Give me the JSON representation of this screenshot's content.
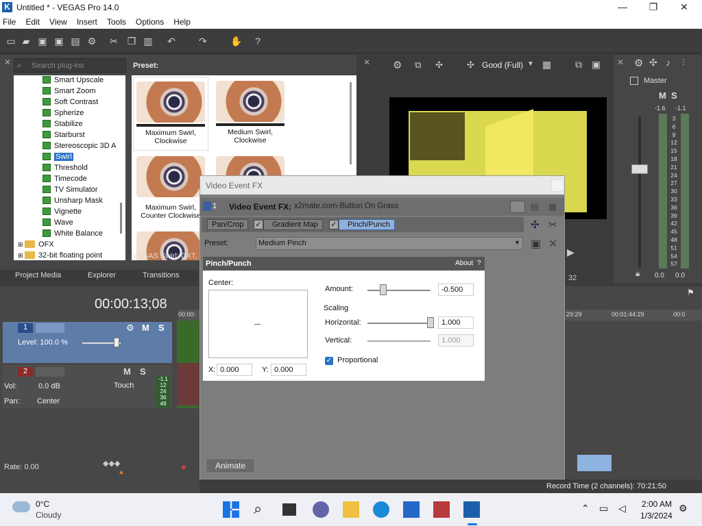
{
  "window": {
    "title": "Untitled * - VEGAS Pro 14.0",
    "logo": "K",
    "min": "—",
    "max": "❐",
    "close": "✕"
  },
  "menu": [
    "File",
    "Edit",
    "View",
    "Insert",
    "Tools",
    "Options",
    "Help"
  ],
  "plugins": {
    "search_placeholder": "Search plug-ins",
    "preset_label": "Preset:",
    "items": [
      "Smart Upscale",
      "Smart Zoom",
      "Soft Contrast",
      "Spherize",
      "Stabilize",
      "Starburst",
      "Stereoscopic 3D A",
      "Swirl",
      "Threshold",
      "Timecode",
      "TV Simulator",
      "Unsharp Mask",
      "Vignette",
      "Wave",
      "White Balance"
    ],
    "folders": [
      "OFX",
      "32-bit floating point"
    ],
    "selected": "Swirl",
    "presets": [
      "Maximum Swirl, Clockwise",
      "Medium Swirl, Clockwise",
      "Maximum Swirl, Counter Clockwise",
      ""
    ],
    "status": "VEGAS Swirl: DXT, 3",
    "tabs": [
      "Project Media",
      "Explorer",
      "Transitions"
    ]
  },
  "preview": {
    "quality": "Good (Full)",
    "frame": "32"
  },
  "mixer": {
    "title": "Master",
    "m": "M",
    "s": "S",
    "peak_l": "-1.6",
    "peak_r": "-1.1",
    "scale": [
      "3",
      "6",
      "9",
      "12",
      "15",
      "18",
      "21",
      "24",
      "27",
      "30",
      "33",
      "36",
      "39",
      "42",
      "45",
      "48",
      "51",
      "54",
      "57"
    ],
    "bottom_l": "0.0",
    "bottom_r": "0.0"
  },
  "timeline": {
    "timecode": "00:00:13;08",
    "ruler": [
      "00:00:",
      "29:29",
      "00:01:44:29",
      "00:0"
    ],
    "track1": {
      "num": "1",
      "level": "Level: 100.0 %",
      "m": "M",
      "s": "S"
    },
    "track2": {
      "num": "2",
      "vol_label": "Vol:",
      "vol": "0.0 dB",
      "pan_label": "Pan:",
      "pan": "Center",
      "touch": "Touch",
      "m": "M",
      "s": "S",
      "meter": [
        "-1.1",
        "12",
        "24",
        "36",
        "48"
      ]
    },
    "rate": "Rate: 0.00",
    "record_time": "Record Time (2 channels): 70:21:50"
  },
  "dialog": {
    "title": "Video Event FX",
    "header_num": "1",
    "header_label": "Video Event FX:",
    "header_name": "x2mate.com-Button On Grass",
    "chain": [
      "Pan/Crop",
      "Gradient Map",
      "Pinch/Punch"
    ],
    "preset_label": "Preset:",
    "preset_value": "Medium Pinch",
    "plugin_title": "Pinch/Punch",
    "about": "About",
    "about_q": "?",
    "center_label": "Center:",
    "x_label": "X:",
    "x_value": "0.000",
    "y_label": "Y:",
    "y_value": "0.000",
    "amount_label": "Amount:",
    "amount_value": "-0.500",
    "scaling_label": "Scaling",
    "horizontal_label": "Horizontal:",
    "horizontal_value": "1.000",
    "vertical_label": "Vertical:",
    "vertical_value": "1.000",
    "proportional_label": "Proportional",
    "animate": "Animate"
  },
  "taskbar": {
    "temp": "0°C",
    "weather": "Cloudy",
    "time": "2:00 AM",
    "date": "1/3/2024"
  }
}
